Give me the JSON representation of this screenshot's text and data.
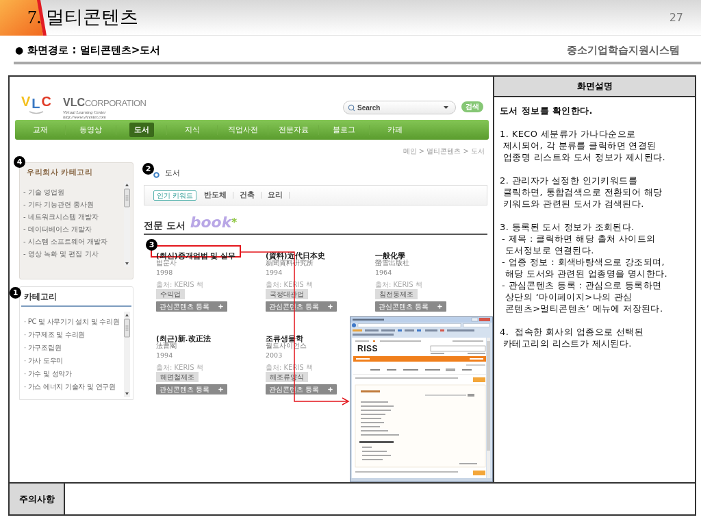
{
  "slide": {
    "title": "7. 멀티콘텐츠",
    "page_number": "27"
  },
  "path": {
    "bullet": "●",
    "text": "화면경로 : 멀티콘텐츠>도서",
    "system_name": "중소기업학습지원시스템"
  },
  "site": {
    "logo": {
      "letters": [
        {
          "char": "V",
          "color": "#f4c01e"
        },
        {
          "char": "L",
          "color": "#3a78c3"
        },
        {
          "char": "C",
          "color": "#e03a26"
        }
      ],
      "brand": "VLC",
      "brand_suffix": "CORPORATION",
      "tagline": "Virtual Learning Center",
      "url": "http://www.vlcenter.com"
    },
    "search": {
      "label": "Search",
      "button": "검색"
    },
    "nav": [
      {
        "label": "교재",
        "selected": false
      },
      {
        "label": "동영상",
        "selected": false
      },
      {
        "label": "도서",
        "selected": true
      },
      {
        "label": "지식",
        "selected": false
      },
      {
        "label": "직업사전",
        "selected": false
      },
      {
        "label": "전문자료",
        "selected": false
      },
      {
        "label": "블로그",
        "selected": false
      },
      {
        "label": "카페",
        "selected": false
      }
    ],
    "breadcrumb": "메인 > 멀티콘텐츠 > 도서",
    "company_categories": {
      "marker": "4",
      "title": "우리회사 카테고리",
      "items": [
        "- 기술 영업원",
        "- 기타 기능관련 종사원",
        "- 네트워크시스템 개발자",
        "- 데이터베이스 개발자",
        "- 시스템 소프트웨어 개발자",
        "- 영상 녹화 및 편집 기사"
      ]
    },
    "categories": {
      "marker": "1",
      "title": "카테고리",
      "items": [
        "· PC 및 사무기기 설치 및 수리원",
        "· 가구제조 및 수리원",
        "· 가구조립원",
        "· 가사 도우미",
        "· 가수 및 성악가",
        "· 가스 에너지 기술자 및 연구원"
      ]
    },
    "books_section": {
      "marker": "2",
      "heading": "도서",
      "keyword_tag": "인기 키워드",
      "keywords": [
        "반도체",
        "건축",
        "요리"
      ],
      "section_title": "전문 도서",
      "logo_word": "book",
      "logo_mark": "*",
      "books": [
        {
          "title": "(최신)중개업법 및 실무",
          "publisher": "법문사",
          "year": "1998",
          "source": "출처: KERIS 책",
          "industry": "수익업",
          "action": "관심콘텐츠 등록",
          "highlighted": true,
          "marker": "3"
        },
        {
          "title": "(資料)近代日本史",
          "publisher": "新聞資料硏究所",
          "year": "1994",
          "source": "출처: KERIS 책",
          "industry": "국정대관업",
          "action": "관심콘텐츠 등록",
          "highlighted": false
        },
        {
          "title": "一般化學",
          "publisher": "螢雪出版社",
          "year": "1964",
          "source": "출처: KERIS 책",
          "industry": "침전동제조",
          "action": "관심콘텐츠 등록",
          "highlighted": false
        },
        {
          "title": "(최근)新.改正法",
          "publisher": "法曹閣",
          "year": "1994",
          "source": "출처: KERIS 책",
          "industry": "해면철제조",
          "action": "관심콘텐츠 등록",
          "highlighted": false
        },
        {
          "title": "조류생물학",
          "publisher": "월드사이언스",
          "year": "2003",
          "source": "출처: KERIS 책",
          "industry": "해조류양식",
          "action": "관심콘텐츠 등록",
          "highlighted": false
        }
      ]
    },
    "linked_page": {
      "logo": "RISS"
    }
  },
  "description": {
    "title": "화면설명",
    "items": [
      {
        "kind": "summary",
        "lines": [
          "도서 정보를 확인한다."
        ]
      },
      {
        "kind": "item",
        "lines": [
          "1. KECO 세분류가 가나다순으로",
          "제시되어, 각 분류를 클릭하면 연결된",
          "업종명 리스트와 도서 정보가 제시된다."
        ]
      },
      {
        "kind": "item",
        "lines": [
          "2. 관리자가 설정한 인기키워드를",
          "클릭하면, 통합검색으로 전환되어 해당",
          "키워드와 관련된 도서가 검색된다."
        ]
      },
      {
        "kind": "item",
        "lines": [
          "3. 등록된 도서 정보가 조회된다."
        ],
        "sub_items": [
          {
            "lines": [
              "- 제목 : 클릭하면 해당 출처 사이트의",
              "도서정보로 연결된다."
            ]
          },
          {
            "lines": [
              "- 업종 정보 : 회색바탕색으로 강조되며,",
              "해당 도서와 관련된 업종명을 명시한다."
            ]
          },
          {
            "lines": [
              "- 관심콘텐츠 등록 : 관심으로 등록하면",
              "상단의 ‘마이페이지>나의 관심",
              "콘텐츠>멀티콘텐츠’ 메뉴에 저장된다."
            ]
          }
        ]
      },
      {
        "kind": "item",
        "lines": [
          "4.  접속한 회사의 업종으로 선택된",
          "카테고리의 리스트가 제시된다."
        ]
      }
    ]
  },
  "notes": {
    "label": "주의사항"
  }
}
